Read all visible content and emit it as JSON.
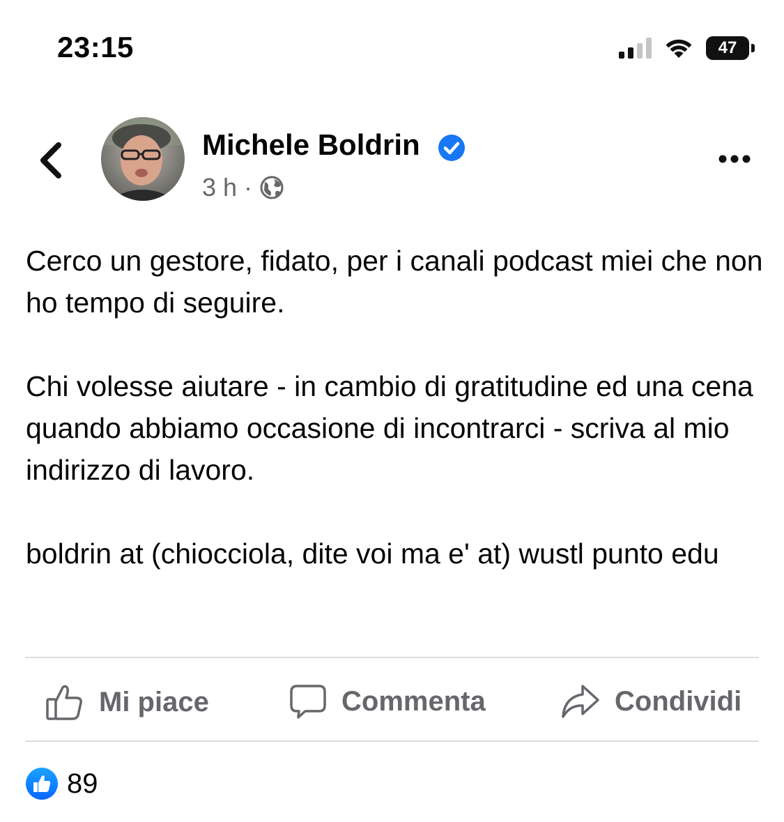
{
  "status_bar": {
    "time": "23:15",
    "battery": "47"
  },
  "post": {
    "author": "Michele Boldrin",
    "time": "3 h",
    "separator": "·",
    "paragraphs": [
      "Cerco un gestore, fidato, per i canali podcast miei che non ho tempo di seguire.",
      "Chi volesse aiutare - in cambio di gratitudine ed una cena quando abbiamo occasione di incontrarci - scriva al mio indirizzo di lavoro.",
      "boldrin at (chiocciola, dite voi ma e' at) wustl punto edu"
    ]
  },
  "actions": {
    "like": "Mi piace",
    "comment": "Commenta",
    "share": "Condividi"
  },
  "reactions": {
    "count": "89"
  },
  "colors": {
    "accent": "#1877f2",
    "secondary_text": "#65676b"
  }
}
